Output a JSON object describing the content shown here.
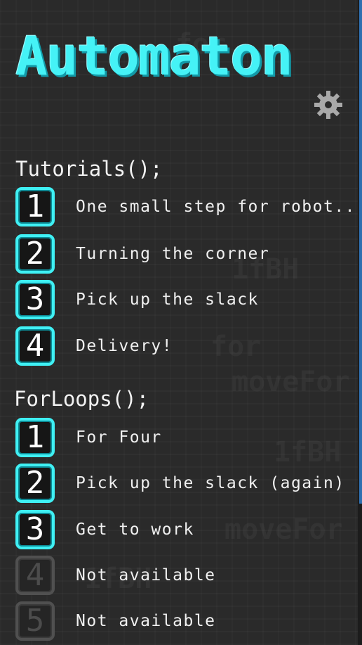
{
  "title": "Automaton",
  "icons": {
    "settings": "gear-icon"
  },
  "colors": {
    "accent": "#45f2f6",
    "locked": "#505050",
    "background": "#2b2b2b"
  },
  "sections": [
    {
      "heading": "Tutorials();",
      "levels": [
        {
          "number": "1",
          "label": "One small step for robot..",
          "locked": false
        },
        {
          "number": "2",
          "label": "Turning the corner",
          "locked": false
        },
        {
          "number": "3",
          "label": "Pick up the slack",
          "locked": false
        },
        {
          "number": "4",
          "label": "Delivery!",
          "locked": false
        }
      ]
    },
    {
      "heading": "ForLoops();",
      "levels": [
        {
          "number": "1",
          "label": "For Four",
          "locked": false
        },
        {
          "number": "2",
          "label": "Pick up the slack (again)",
          "locked": false
        },
        {
          "number": "3",
          "label": "Get to work",
          "locked": false
        },
        {
          "number": "4",
          "label": "Not available",
          "locked": true
        },
        {
          "number": "5",
          "label": "Not available",
          "locked": true
        }
      ]
    }
  ]
}
